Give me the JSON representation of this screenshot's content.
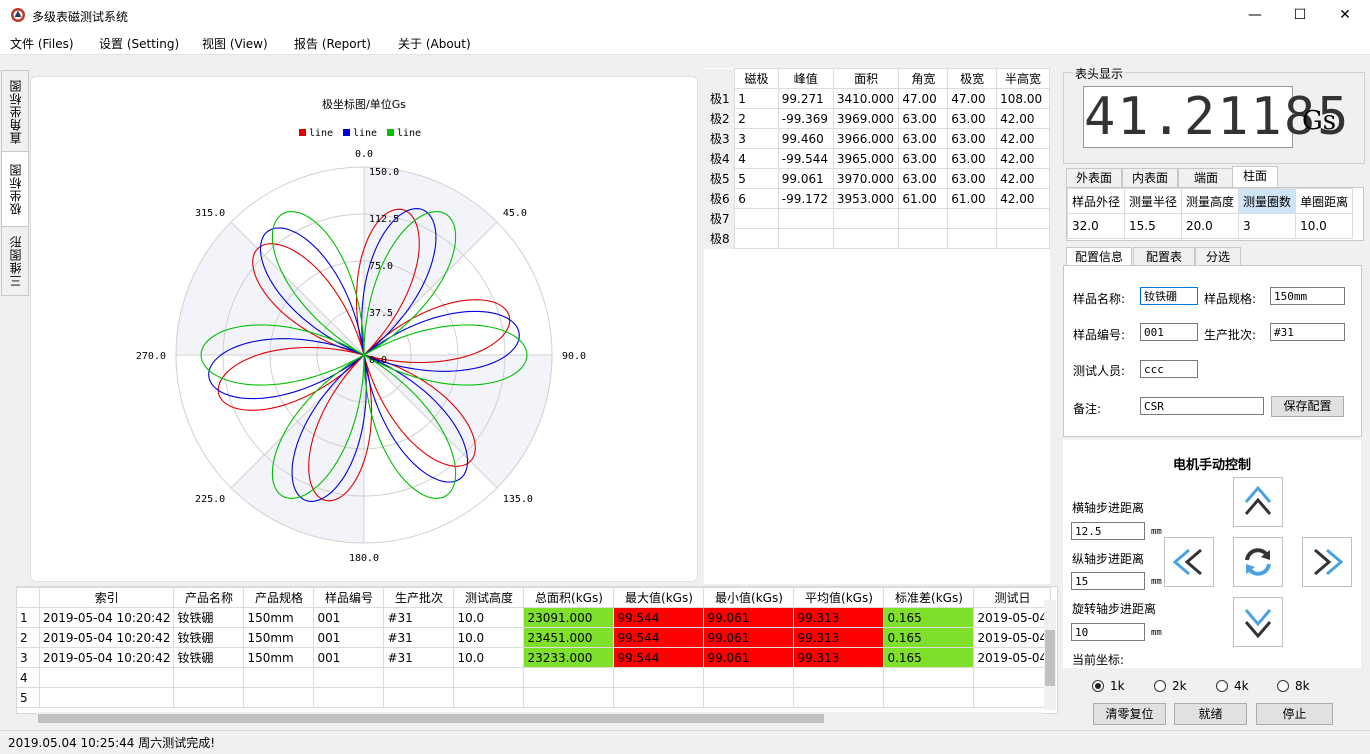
{
  "window": {
    "title": "多级表磁测试系统",
    "minimize": "—",
    "maximize": "☐",
    "close": "✕"
  },
  "menu": [
    "文件 (Files)",
    "设置 (Setting)",
    "视图 (View)",
    "报告 (Report)",
    "关于 (About)"
  ],
  "side_tabs": [
    "直角坐标图",
    "极坐标图",
    "三维图形"
  ],
  "chart_data": {
    "type": "polar-line",
    "title": "极坐标图/单位Gs",
    "legend": [
      "line",
      "line",
      "line"
    ],
    "angle_labels": [
      "0.0",
      "45.0",
      "90.0",
      "135.0",
      "180.0",
      "225.0",
      "270.0",
      "315.0"
    ],
    "radial_labels": [
      "0.0",
      "37.5",
      "75.0",
      "112.5",
      "150.0"
    ],
    "rlim": [
      0,
      150
    ],
    "series": [
      {
        "color": "#e00000",
        "petals": 6,
        "amplitude": 120,
        "phase_deg": 15
      },
      {
        "color": "#0000e0",
        "petals": 6,
        "amplitude": 125,
        "phase_deg": 8
      },
      {
        "color": "#00c000",
        "petals": 6,
        "amplitude": 130,
        "phase_deg": 0
      }
    ],
    "shaded_sectors": true
  },
  "pole_table": {
    "headers": [
      "磁极",
      "峰值",
      "面积",
      "角宽",
      "极宽",
      "半高宽"
    ],
    "rows": [
      {
        "label": "极1",
        "cells": [
          "1",
          "99.271",
          "3410.000",
          "47.00",
          "47.00",
          "108.00"
        ]
      },
      {
        "label": "极2",
        "cells": [
          "2",
          "-99.369",
          "3969.000",
          "63.00",
          "63.00",
          "42.00"
        ]
      },
      {
        "label": "极3",
        "cells": [
          "3",
          "99.460",
          "3966.000",
          "63.00",
          "63.00",
          "42.00"
        ]
      },
      {
        "label": "极4",
        "cells": [
          "4",
          "-99.544",
          "3965.000",
          "63.00",
          "63.00",
          "42.00"
        ]
      },
      {
        "label": "极5",
        "cells": [
          "5",
          "99.061",
          "3970.000",
          "63.00",
          "63.00",
          "42.00"
        ]
      },
      {
        "label": "极6",
        "cells": [
          "6",
          "-99.172",
          "3953.000",
          "61.00",
          "61.00",
          "42.00"
        ]
      },
      {
        "label": "极7",
        "cells": [
          "",
          "",
          "",
          "",
          "",
          ""
        ]
      },
      {
        "label": "极8",
        "cells": [
          "",
          "",
          "",
          "",
          "",
          ""
        ]
      }
    ]
  },
  "meter": {
    "label": "表头显示",
    "value": "41.21185",
    "unit": "Gs"
  },
  "surface_tabs": [
    "外表面",
    "内表面",
    "端面",
    "柱面"
  ],
  "surface_table": {
    "headers": [
      "样品外径",
      "测量半径",
      "测量高度",
      "测量圈数",
      "单圈距离"
    ],
    "values": [
      "32.0",
      "15.5",
      "20.0",
      "3",
      "10.0"
    ]
  },
  "config_tabs": [
    "配置信息",
    "配置表",
    "分选"
  ],
  "config": {
    "name_label": "样品名称:",
    "name": "钕铁硼",
    "spec_label": "样品规格:",
    "spec": "150mm",
    "no_label": "样品编号:",
    "no": "001",
    "batch_label": "生产批次:",
    "batch": "#31",
    "tester_label": "测试人员:",
    "tester": "ccc",
    "note_label": "备注:",
    "note": "CSR",
    "save": "保存配置"
  },
  "motor": {
    "title": "电机手动控制",
    "x_label": "横轴步进距离",
    "x_value": "12.5",
    "y_label": "纵轴步进距离",
    "y_value": "15",
    "r_label": "旋转轴步进距离",
    "r_value": "10",
    "unit": "mm",
    "coord_label": "当前坐标:"
  },
  "rate": [
    "1k",
    "2k",
    "4k",
    "8k"
  ],
  "actions": [
    "清零复位",
    "就绪",
    "停止"
  ],
  "results": {
    "headers": [
      "索引",
      "产品名称",
      "产品规格",
      "样品编号",
      "生产批次",
      "测试高度",
      "总面积(kGs)",
      "最大值(kGs)",
      "最小值(kGs)",
      "平均值(kGs)",
      "标准差(kGs)",
      "测试日"
    ],
    "row_numbers": [
      "1",
      "2",
      "3",
      "4",
      "5"
    ],
    "rows": [
      [
        "2019-05-04 10:20:42",
        "钕铁硼",
        "150mm",
        "001",
        "#31",
        "10.0",
        "23091.000",
        "99.544",
        "99.061",
        "99.313",
        "0.165",
        "2019-05-04"
      ],
      [
        "2019-05-04 10:20:42",
        "钕铁硼",
        "150mm",
        "001",
        "#31",
        "10.0",
        "23451.000",
        "99.544",
        "99.061",
        "99.313",
        "0.165",
        "2019-05-04"
      ],
      [
        "2019-05-04 10:20:42",
        "钕铁硼",
        "150mm",
        "001",
        "#31",
        "10.0",
        "23233.000",
        "99.544",
        "99.061",
        "99.313",
        "0.165",
        "2019-05-04"
      ]
    ]
  },
  "status": "2019.05.04 10:25:44 周六测试完成!"
}
